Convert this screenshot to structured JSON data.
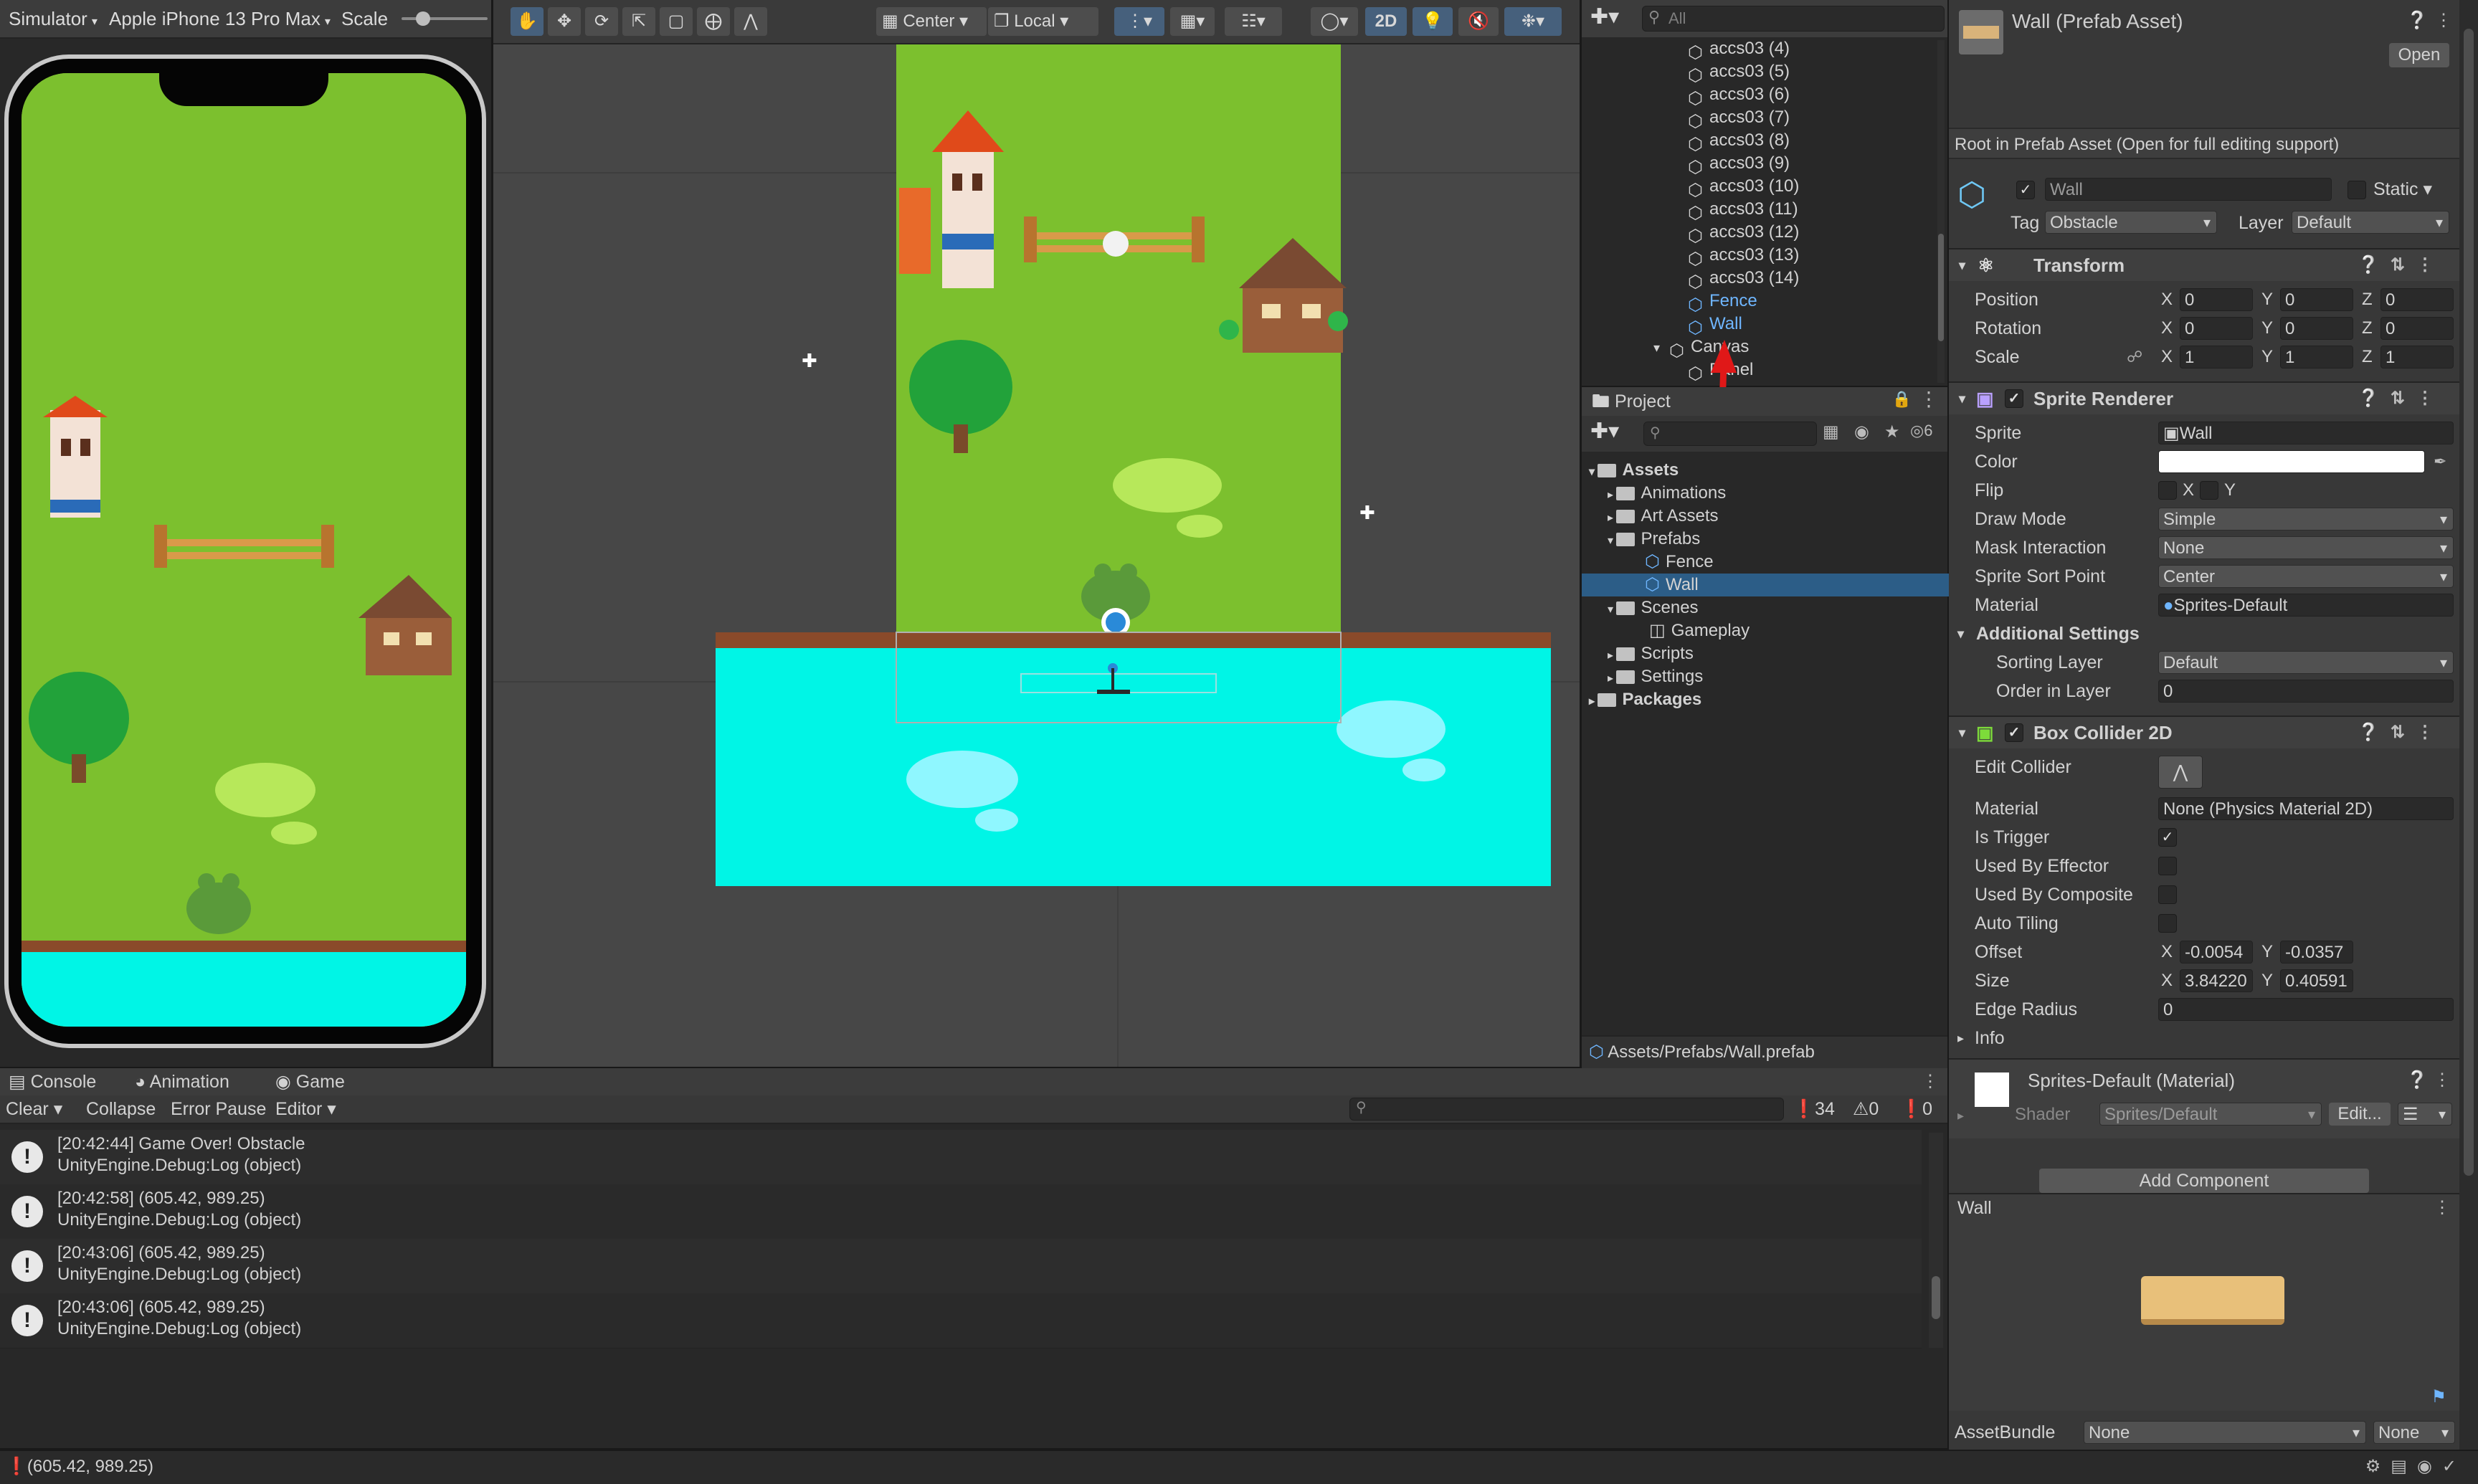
{
  "simulator": {
    "mode_label": "Simulator",
    "device_label": "Apple iPhone 13 Pro Max",
    "scale_label": "Scale"
  },
  "scene_toolbar": {
    "pivot_label": "Center",
    "space_label": "Local",
    "twod_label": "2D"
  },
  "hierarchy": {
    "search_placeholder": "All",
    "items": [
      {
        "label": "accs03 (4)"
      },
      {
        "label": "accs03 (5)"
      },
      {
        "label": "accs03 (6)"
      },
      {
        "label": "accs03 (7)"
      },
      {
        "label": "accs03 (8)"
      },
      {
        "label": "accs03 (9)"
      },
      {
        "label": "accs03 (10)"
      },
      {
        "label": "accs03 (11)"
      },
      {
        "label": "accs03 (12)"
      },
      {
        "label": "accs03 (13)"
      },
      {
        "label": "accs03 (14)"
      },
      {
        "label": "Fence"
      },
      {
        "label": "Wall"
      },
      {
        "label": "Canvas"
      },
      {
        "label": "Panel"
      }
    ]
  },
  "project": {
    "tab_label": "Project",
    "hidden_count": "6",
    "tree": [
      {
        "label": "Assets"
      },
      {
        "label": "Animations"
      },
      {
        "label": "Art Assets"
      },
      {
        "label": "Prefabs"
      },
      {
        "label": "Fence"
      },
      {
        "label": "Wall"
      },
      {
        "label": "Scenes"
      },
      {
        "label": "Gameplay"
      },
      {
        "label": "Scripts"
      },
      {
        "label": "Settings"
      },
      {
        "label": "Packages"
      }
    ],
    "footer_path": "Assets/Prefabs/Wall.prefab"
  },
  "inspector": {
    "title": "Wall (Prefab Asset)",
    "open_button": "Open",
    "root_note": "Root in Prefab Asset (Open for full editing support)",
    "object_name": "Wall",
    "static_label": "Static",
    "tag_label": "Tag",
    "tag_value": "Obstacle",
    "layer_label": "Layer",
    "layer_value": "Default",
    "transform": {
      "title": "Transform",
      "position_label": "Position",
      "rotation_label": "Rotation",
      "scale_label": "Scale",
      "position": [
        "0",
        "0",
        "0"
      ],
      "rotation": [
        "0",
        "0",
        "0"
      ],
      "scale": [
        "1",
        "1",
        "1"
      ]
    },
    "axis": {
      "x": "X",
      "y": "Y",
      "z": "Z"
    },
    "sprite_renderer": {
      "title": "Sprite Renderer",
      "sprite_label": "Sprite",
      "sprite_value": "Wall",
      "color_label": "Color",
      "flip_label": "Flip",
      "draw_mode_label": "Draw Mode",
      "draw_mode_value": "Simple",
      "mask_label": "Mask Interaction",
      "mask_value": "None",
      "sort_point_label": "Sprite Sort Point",
      "sort_point_value": "Center",
      "material_label": "Material",
      "material_value": "Sprites-Default",
      "additional_label": "Additional Settings",
      "sorting_layer_label": "Sorting Layer",
      "sorting_layer_value": "Default",
      "order_label": "Order in Layer",
      "order_value": "0"
    },
    "box_collider": {
      "title": "Box Collider 2D",
      "edit_collider_label": "Edit Collider",
      "material_label": "Material",
      "material_value": "None (Physics Material 2D)",
      "is_trigger_label": "Is Trigger",
      "used_by_effector_label": "Used By Effector",
      "used_by_composite_label": "Used By Composite",
      "auto_tiling_label": "Auto Tiling",
      "offset_label": "Offset",
      "offset_x": "-0.0054",
      "offset_y": "-0.0357",
      "size_label": "Size",
      "size_x": "3.84220",
      "size_y": "0.40591",
      "edge_radius_label": "Edge Radius",
      "edge_radius_value": "0",
      "info_label": "Info"
    },
    "material_section": {
      "title": "Sprites-Default (Material)",
      "shader_label": "Shader",
      "shader_value": "Sprites/Default",
      "edit_button": "Edit..."
    },
    "add_component": "Add Component",
    "preview_title": "Wall",
    "assetbundle_label": "AssetBundle",
    "assetbundle_value": "None",
    "assetbundle_variant": "None"
  },
  "console": {
    "tabs": [
      {
        "label": "Console"
      },
      {
        "label": "Animation"
      },
      {
        "label": "Game"
      }
    ],
    "clear_label": "Clear",
    "collapse_label": "Collapse",
    "error_pause_label": "Error Pause",
    "editor_label": "Editor",
    "count_info": "34",
    "count_warn": "0",
    "count_error": "0",
    "logs": [
      {
        "line1": "[20:42:44] Game Over! Obstacle",
        "line2": "UnityEngine.Debug:Log (object)"
      },
      {
        "line1": "[20:42:58] (605.42, 989.25)",
        "line2": "UnityEngine.Debug:Log (object)"
      },
      {
        "line1": "[20:43:06] (605.42, 989.25)",
        "line2": "UnityEngine.Debug:Log (object)"
      },
      {
        "line1": "[20:43:06] (605.42, 989.25)",
        "line2": "UnityEngine.Debug:Log (object)"
      }
    ]
  },
  "status_bar": {
    "message": "(605.42, 989.25)"
  },
  "colors": {
    "grass": "#7cc02e",
    "water": "#00f5e6",
    "dirt_edge": "#8a4a2a",
    "selection_blue": "#2c5d87",
    "link_blue": "#6fb6ff",
    "arrow_red": "#e01818"
  }
}
